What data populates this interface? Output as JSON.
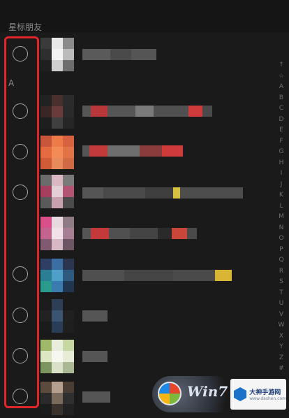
{
  "header": {
    "starred_label": "星标朋友"
  },
  "sections": {
    "a_label": "A"
  },
  "index_letters": [
    "↑",
    "☆",
    "A",
    "B",
    "C",
    "D",
    "E",
    "F",
    "G",
    "H",
    "I",
    "J",
    "K",
    "L",
    "M",
    "N",
    "O",
    "P",
    "Q",
    "R",
    "S",
    "T",
    "U",
    "V",
    "W",
    "X",
    "Y",
    "Z",
    "#"
  ],
  "watermark": {
    "win_text": "Win7",
    "site_title": "大神手游网",
    "site_url": "www.dashen.com"
  },
  "colors": {
    "accent": "#e0262a",
    "background": "#1a1a1a"
  }
}
